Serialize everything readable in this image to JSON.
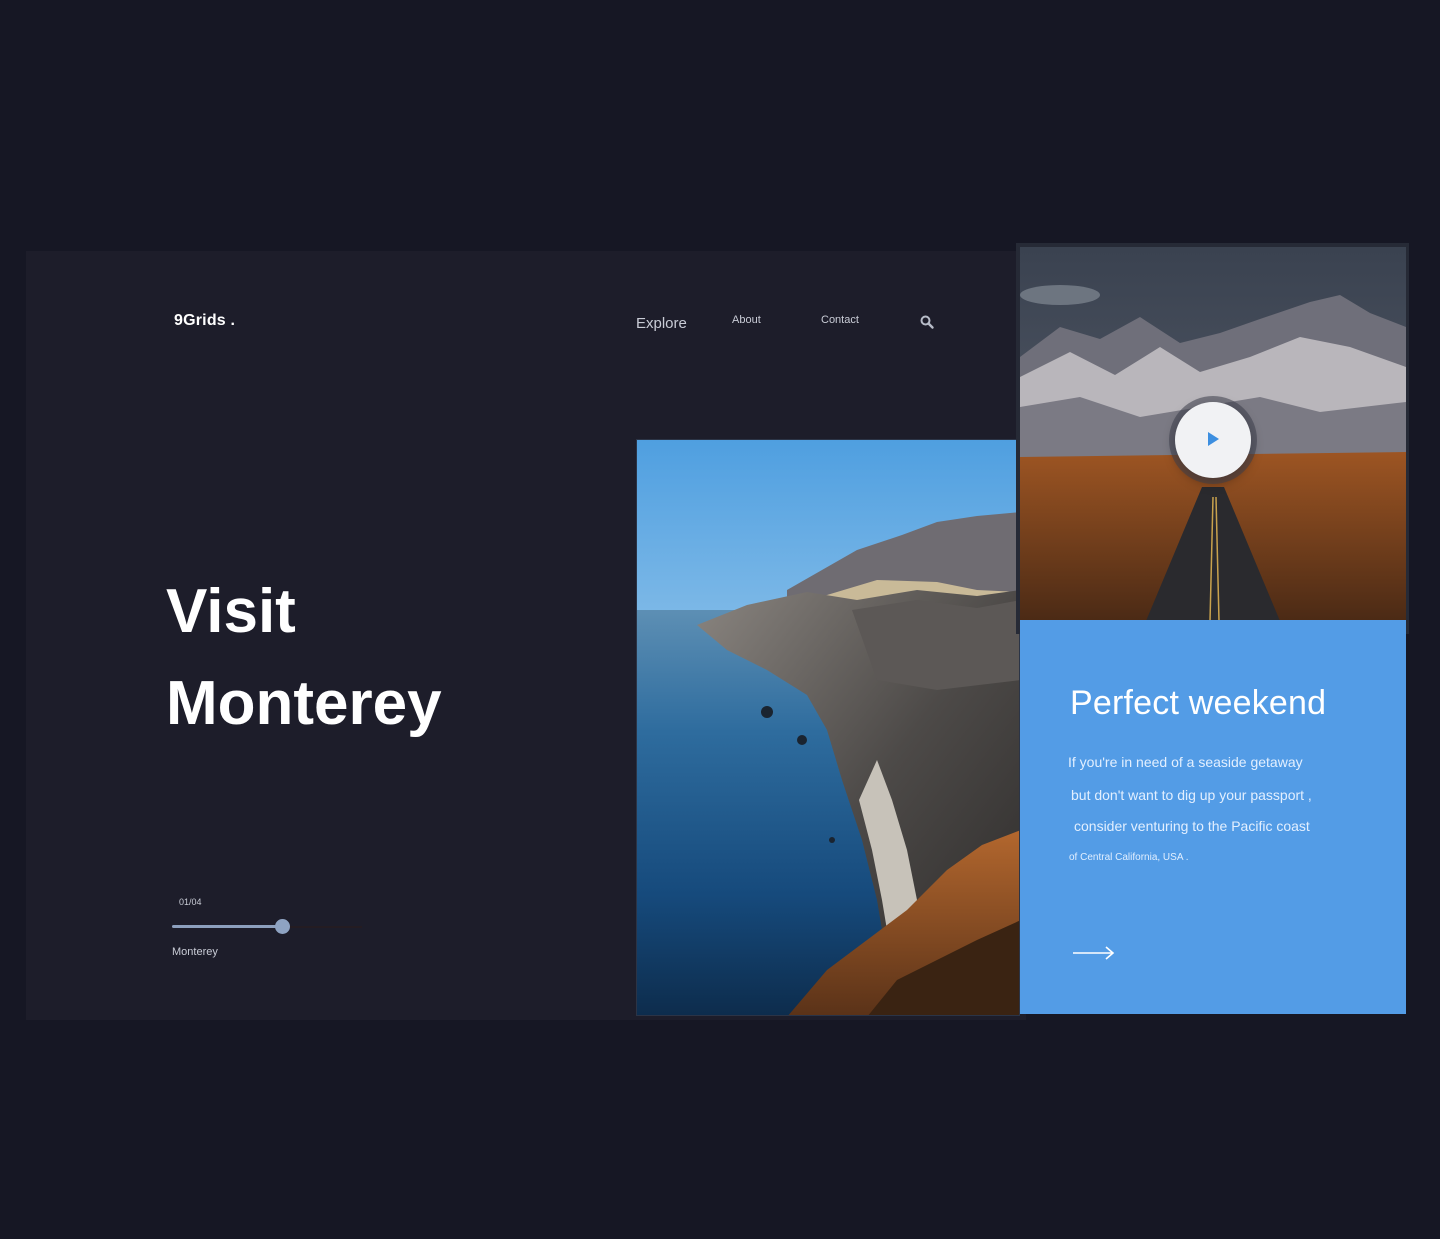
{
  "brand": {
    "logo": "9Grids ."
  },
  "nav": {
    "items": [
      {
        "label": "Explore"
      },
      {
        "label": "About"
      },
      {
        "label": "Contact"
      }
    ],
    "search_icon": "search-icon"
  },
  "hero": {
    "title_line1": "Visit",
    "title_line2": "Monterey"
  },
  "slider": {
    "counter": "01/04",
    "current_name": "Monterey",
    "progress": 0.58
  },
  "video": {
    "play_icon": "play-icon"
  },
  "card": {
    "title": "Perfect weekend",
    "lines": [
      "If you're in need of a seaside getaway",
      "but don't want to dig up your passport ,",
      "consider venturing to the Pacific coast",
      "of Central California, USA ."
    ],
    "arrow_icon": "arrow-right-icon"
  },
  "colors": {
    "page_background": "#161724",
    "frame_background": "#1d1d2a",
    "accent_blue": "#539ce6",
    "slider_fill": "#8c9fbd"
  }
}
